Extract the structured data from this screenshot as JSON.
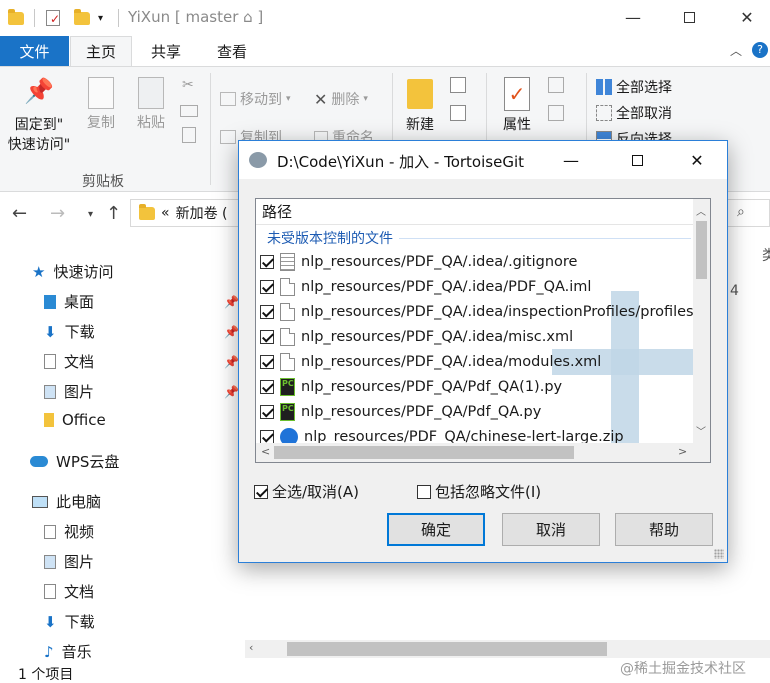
{
  "explorer": {
    "title": "YiXun [ master ⌂ ]",
    "tabs": {
      "file": "文件",
      "home": "主页",
      "share": "共享",
      "view": "查看"
    },
    "ribbon": {
      "pin_label_1": "固定到\"",
      "pin_label_2": "快速访问\"",
      "copy": "复制",
      "paste": "粘贴",
      "move_to": "移动到",
      "copy_to": "复制到",
      "delete": "删除",
      "rename": "重命名",
      "new": "新建",
      "properties": "属性",
      "select_all": "全部选择",
      "select_none": "全部取消",
      "invert_selection": "反向选择",
      "clipboard_group": "剪贴板"
    },
    "address": {
      "prefix": "«",
      "path": "新加卷 ("
    },
    "nav": {
      "quick_access": "快速访问",
      "desktop": "桌面",
      "downloads": "下载",
      "documents": "文档",
      "pictures": "图片",
      "office": "Office",
      "wps_cloud": "WPS云盘",
      "this_pc": "此电脑",
      "videos": "视频",
      "pictures2": "图片",
      "documents2": "文档",
      "downloads2": "下载",
      "music": "音乐"
    },
    "status": "1 个项目",
    "edge_text": {
      "col_header": "类",
      "digit": "4"
    }
  },
  "dialog": {
    "title": "D:\\Code\\YiXun - 加入 - TortoiseGit",
    "column_header": "路径",
    "group_header": "未受版本控制的文件",
    "files": [
      {
        "path": "nlp_resources/PDF_QA/.idea/.gitignore",
        "icon": "text-file-icon",
        "checked": true
      },
      {
        "path": "nlp_resources/PDF_QA/.idea/PDF_QA.iml",
        "icon": "file-icon",
        "checked": true
      },
      {
        "path": "nlp_resources/PDF_QA/.idea/inspectionProfiles/profiles_set",
        "icon": "file-icon",
        "checked": true
      },
      {
        "path": "nlp_resources/PDF_QA/.idea/misc.xml",
        "icon": "file-icon",
        "checked": true
      },
      {
        "path": "nlp_resources/PDF_QA/.idea/modules.xml",
        "icon": "file-icon",
        "checked": true
      },
      {
        "path": "nlp_resources/PDF_QA/Pdf_QA(1).py",
        "icon": "pycharm-icon",
        "checked": true
      },
      {
        "path": "nlp_resources/PDF_QA/Pdf_QA.py",
        "icon": "pycharm-icon",
        "checked": true
      },
      {
        "path": "nlp_resources/PDF_QA/chinese-lert-large.zip",
        "icon": "zip-icon",
        "checked": true
      }
    ],
    "select_all_label": "全选/取消(A)",
    "include_ignored_label": "包括忽略文件(I)",
    "ok": "确定",
    "cancel": "取消",
    "help": "帮助"
  },
  "watermark": "@稀土掘金技术社区"
}
